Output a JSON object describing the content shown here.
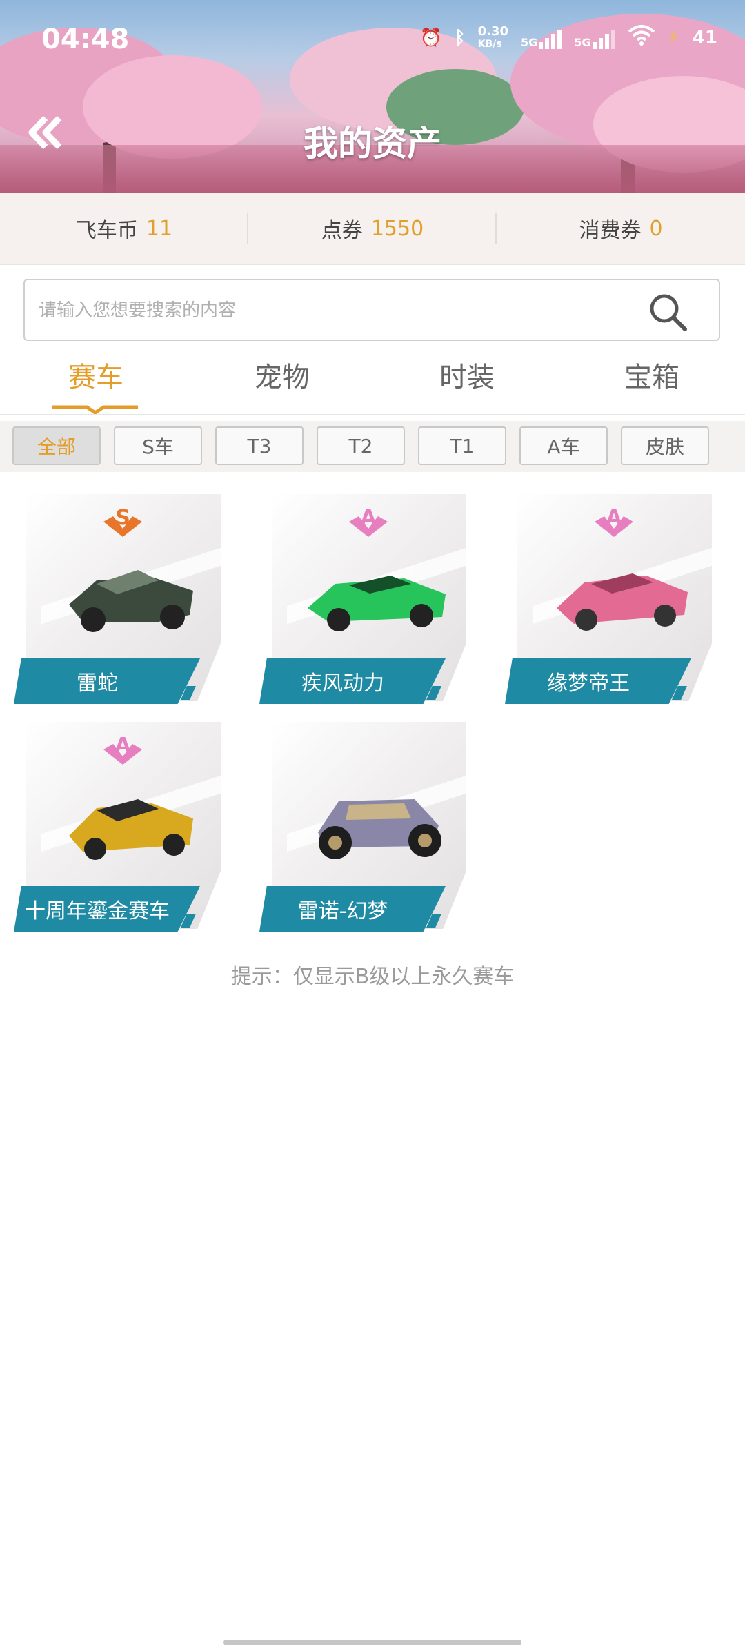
{
  "status_bar": {
    "time": "04:48",
    "net_speed": "0.30",
    "net_unit": "KB/s",
    "sim1": "5G",
    "sim2": "5G",
    "battery": "41"
  },
  "header": {
    "title": "我的资产",
    "back_icon": "double-chevron-left-icon"
  },
  "currency": [
    {
      "label": "飞车币",
      "value": "11"
    },
    {
      "label": "点券",
      "value": "1550"
    },
    {
      "label": "消费券",
      "value": "0"
    }
  ],
  "search": {
    "placeholder": "请输入您想要搜索的内容",
    "icon": "search-icon"
  },
  "tabs": [
    {
      "label": "赛车",
      "active": true
    },
    {
      "label": "宠物",
      "active": false
    },
    {
      "label": "时装",
      "active": false
    },
    {
      "label": "宝箱",
      "active": false
    }
  ],
  "filters": [
    {
      "label": "全部",
      "active": true
    },
    {
      "label": "S车",
      "active": false
    },
    {
      "label": "T3",
      "active": false
    },
    {
      "label": "T2",
      "active": false
    },
    {
      "label": "T1",
      "active": false
    },
    {
      "label": "A车",
      "active": false
    },
    {
      "label": "皮肤",
      "active": false
    }
  ],
  "cars": [
    {
      "name": "雷蛇",
      "grade": "S",
      "color": "#3c4a3e"
    },
    {
      "name": "疾风动力",
      "grade": "A",
      "color": "#26c45a"
    },
    {
      "name": "缘梦帝王",
      "grade": "A",
      "color": "#e36a93"
    },
    {
      "name": "十周年鎏金赛车",
      "grade": "A",
      "color": "#d8a91e"
    },
    {
      "name": "雷诺-幻梦",
      "grade": "",
      "color": "#8a86a8"
    }
  ],
  "hint": "提示：仅显示B级以上永久赛车",
  "colors": {
    "accent": "#e59d2a",
    "label_bg": "#1f8aa3",
    "grade_s": "#e8762a",
    "grade_a": "#e67ec0"
  }
}
